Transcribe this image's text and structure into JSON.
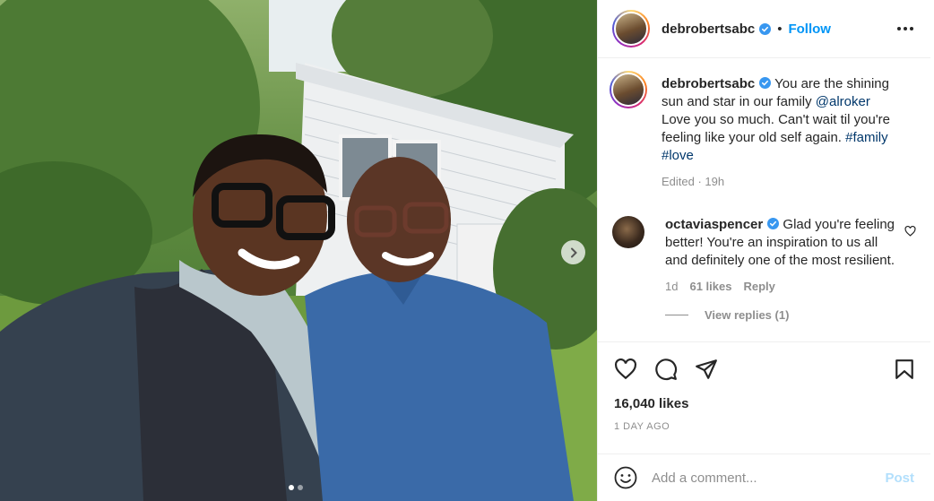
{
  "post": {
    "username": "debrobertsabc",
    "follow_label": "Follow",
    "separator": "•"
  },
  "caption": {
    "username": "debrobertsabc",
    "text_1": "You are the shining sun and star in our family ",
    "mention": "@alroker",
    "text_2": " Love you so much. Can't wait til you're feeling like your old self again. ",
    "hashtag_1": "#family",
    "hashtag_2": "#love",
    "meta": "Edited · 19h"
  },
  "comment": {
    "username": "octaviaspencer",
    "text": "Glad you're feeling better! You're an inspiration to us all and definitely one of the most resilient.",
    "time": "1d",
    "likes": "61 likes",
    "reply_label": "Reply",
    "view_replies": "View replies (1)"
  },
  "stats": {
    "likes": "16,040 likes",
    "date": "1 DAY AGO"
  },
  "add_comment": {
    "placeholder": "Add a comment...",
    "post_label": "Post"
  },
  "colors": {
    "accent": "#0095f6",
    "verified": "#3897f0",
    "post_disabled": "#b2dffc"
  },
  "icons": [
    "more-icon",
    "verified-icon",
    "heart-icon",
    "comment-icon",
    "share-icon",
    "save-icon",
    "emoji-icon",
    "chevron-right-icon"
  ]
}
